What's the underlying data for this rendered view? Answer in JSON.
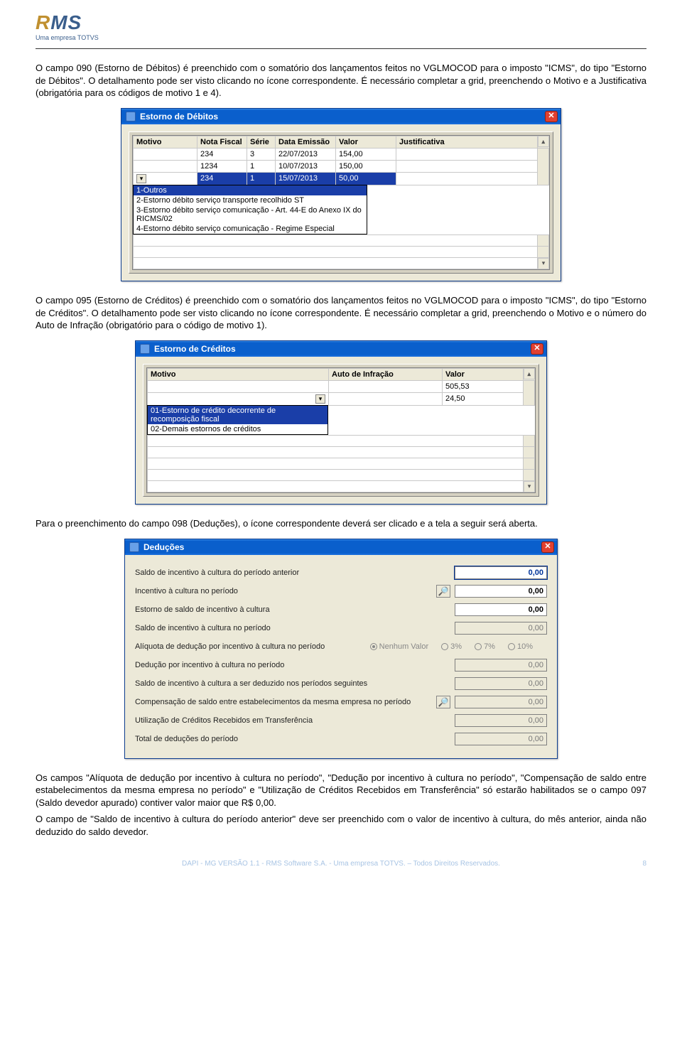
{
  "logo": {
    "main": "RMS",
    "sub": "Uma empresa TOTVS"
  },
  "para1": "O campo 090 (Estorno de Débitos) é preenchido com o somatório dos lançamentos feitos no VGLMOCOD para o imposto \"ICMS\", do tipo \"Estorno de Débitos\". O detalhamento pode ser visto clicando no ícone correspondente. É necessário completar a grid, preenchendo o Motivo e a Justificativa (obrigatória para os códigos de motivo 1 e 4).",
  "win1": {
    "title": "Estorno de Débitos",
    "headers": [
      "Motivo",
      "Nota Fiscal",
      "Série",
      "Data Emissão",
      "Valor",
      "Justificativa"
    ],
    "rows": [
      {
        "motivo": "",
        "nf": "234",
        "serie": "3",
        "data": "22/07/2013",
        "valor": "154,00",
        "just": ""
      },
      {
        "motivo": "",
        "nf": "1234",
        "serie": "1",
        "data": "10/07/2013",
        "valor": "150,00",
        "just": ""
      },
      {
        "motivo": "",
        "nf": "234",
        "serie": "1",
        "data": "15/07/2013",
        "valor": "50,00",
        "just": "",
        "selected": true
      }
    ],
    "dropdown": {
      "selected": "1-Outros",
      "options": [
        "2-Estorno débito serviço transporte recolhido ST",
        "3-Estorno débito serviço comunicação - Art. 44-E do Anexo IX do RICMS/02",
        "4-Estorno débito serviço comunicação - Regime Especial"
      ]
    }
  },
  "para2": "O campo 095 (Estorno de Créditos) é preenchido com o somatório dos lançamentos feitos no VGLMOCOD para o imposto \"ICMS\", do tipo \"Estorno de Créditos\". O detalhamento pode ser visto clicando no ícone correspondente. É necessário completar a grid, preenchendo o Motivo e o número do Auto de Infração (obrigatório para o código de motivo 1).",
  "win2": {
    "title": "Estorno de Créditos",
    "headers": [
      "Motivo",
      "Auto de Infração",
      "Valor"
    ],
    "rows": [
      {
        "motivo": "",
        "auto": "",
        "valor": "505,53"
      },
      {
        "motivo": "",
        "auto": "",
        "valor": "24,50",
        "selected": true
      }
    ],
    "dropdown": {
      "selected": "01-Estorno de crédito decorrente de recomposição fiscal",
      "options": [
        "02-Demais estornos de créditos"
      ]
    }
  },
  "para3": "Para o preenchimento do campo 098 (Deduções), o ícone correspondente deverá ser clicado e a tela a seguir será aberta.",
  "win3": {
    "title": "Deduções",
    "fields": [
      {
        "label": "Saldo de incentivo à cultura do período anterior",
        "value": "0,00",
        "mode": "activeBlue"
      },
      {
        "label": "Incentivo à cultura no período",
        "value": "0,00",
        "mode": "binoc"
      },
      {
        "label": "Estorno de saldo de incentivo à cultura",
        "value": "0,00",
        "mode": "active"
      },
      {
        "label": "Saldo de incentivo à cultura no período",
        "value": "0,00",
        "mode": "disabled"
      },
      {
        "label": "Alíquota de dedução por incentivo à cultura no período",
        "value": "",
        "mode": "radios"
      },
      {
        "label": "Dedução por incentivo à cultura no período",
        "value": "0,00",
        "mode": "disabled"
      },
      {
        "label": "Saldo de incentivo à cultura a ser deduzido nos períodos seguintes",
        "value": "0,00",
        "mode": "disabled"
      },
      {
        "label": "Compensação de saldo entre estabelecimentos da mesma empresa no período",
        "value": "0,00",
        "mode": "binocDisabled"
      },
      {
        "label": "Utilização de Créditos Recebidos em Transferência",
        "value": "0,00",
        "mode": "disabled"
      },
      {
        "label": "Total de deduções do período",
        "value": "0,00",
        "mode": "disabled"
      }
    ],
    "radios": {
      "selLabel": "Nenhum Valor",
      "opts": [
        "3%",
        "7%",
        "10%"
      ]
    }
  },
  "para4": "Os campos \"Alíquota de dedução por incentivo à cultura no período\", \"Dedução por incentivo à cultura no período\", \"Compensação de saldo entre estabelecimentos da mesma empresa no período\" e \"Utilização de Créditos Recebidos em Transferência\" só estarão habilitados se o campo 097 (Saldo devedor apurado) contiver valor maior que R$ 0,00.",
  "para5": "O campo de \"Saldo de incentivo à cultura do período anterior\" deve ser preenchido com o valor de incentivo à cultura, do mês anterior, ainda não deduzido do saldo devedor.",
  "footer": {
    "text": "DAPI - MG VERSÃO 1.1 - RMS Software S.A.  - Uma empresa TOTVS. – Todos Direitos Reservados.",
    "page": "8"
  }
}
